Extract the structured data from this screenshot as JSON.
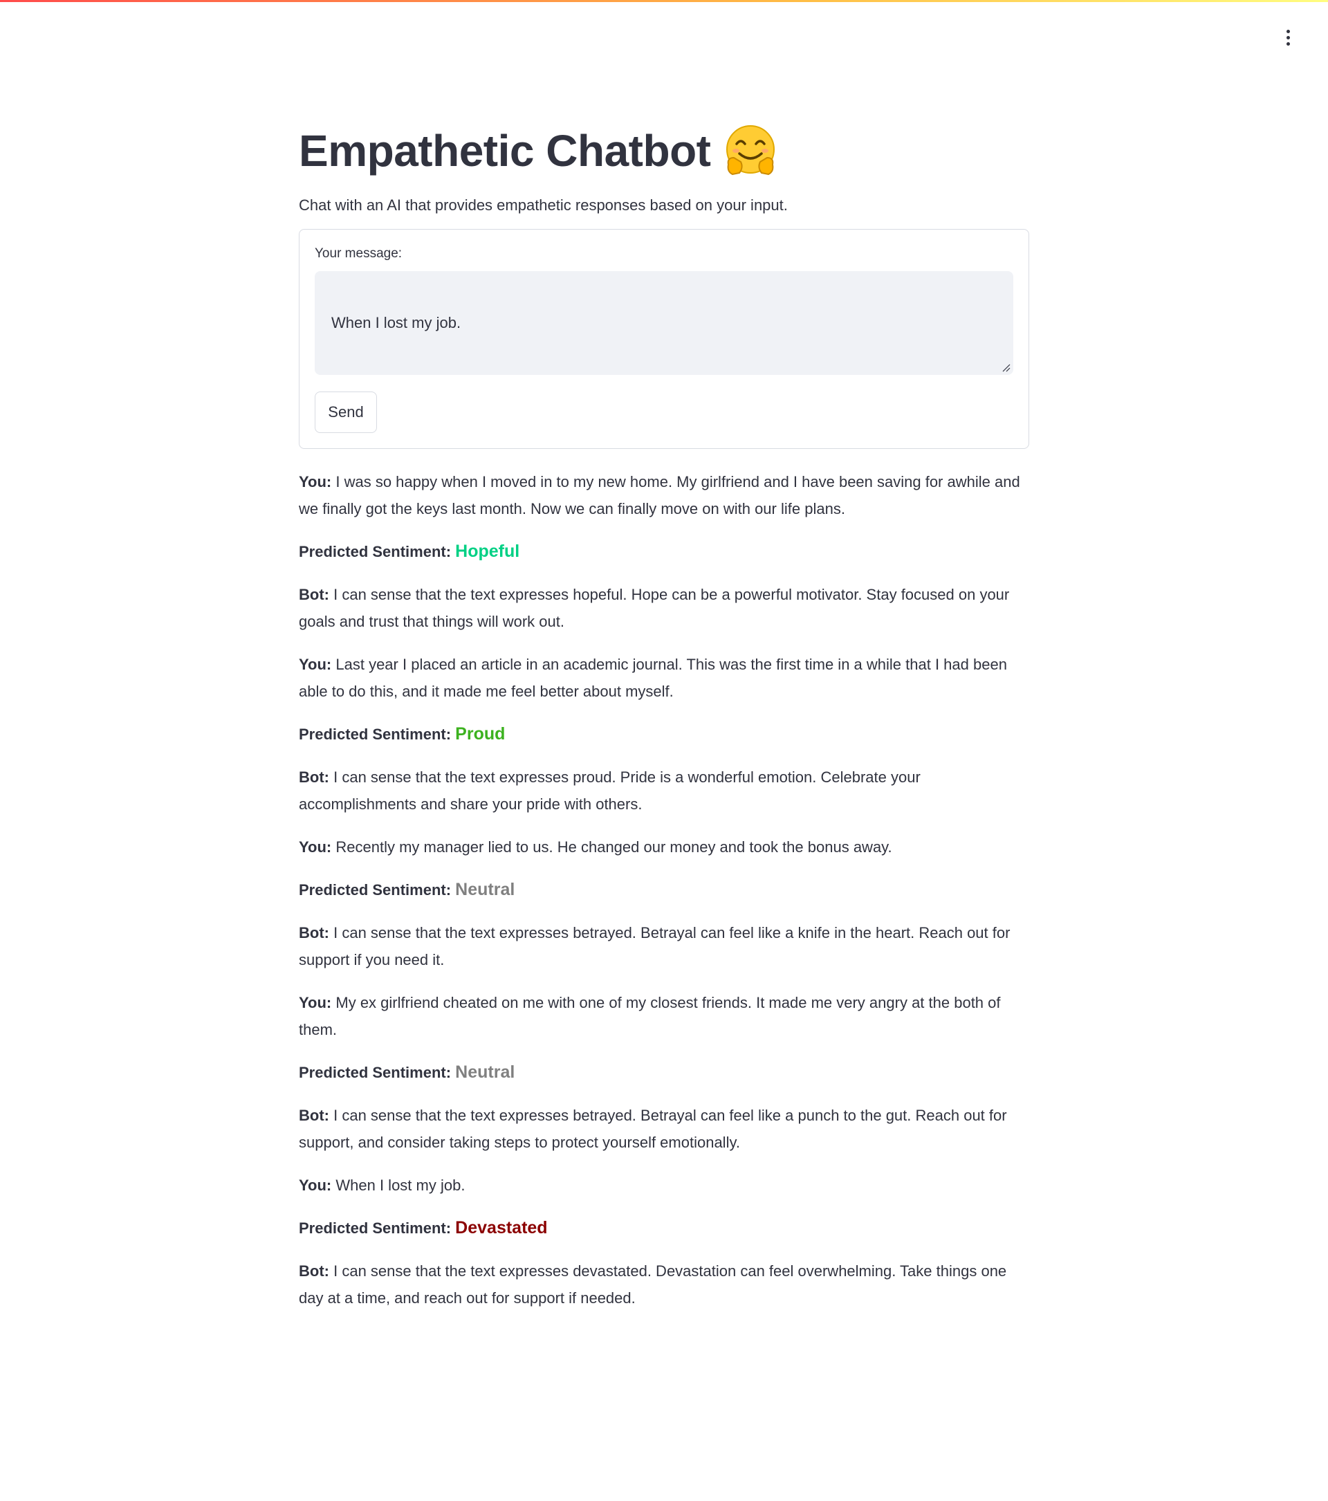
{
  "app": {
    "title": "Empathetic Chatbot",
    "title_emoji": "hugging-face-icon",
    "subtitle": "Chat with an AI that provides empathetic responses based on your input."
  },
  "form": {
    "label": "Your message:",
    "input_value": "When I lost my job.",
    "send_label": "Send"
  },
  "labels": {
    "you": "You:",
    "bot": "Bot:",
    "predicted": "Predicted Sentiment:"
  },
  "colors": {
    "accent_gradient": [
      "#ff4b4b",
      "#ffbd45",
      "#fffd80"
    ],
    "text": "#31333f"
  },
  "conversation": [
    {
      "user": "I was so happy when I moved in to my new home. My girlfriend and I have been saving for awhile and we finally got the keys last month. Now we can finally move on with our life plans.",
      "sentiment": "Hopeful",
      "sentiment_color": "#00d084",
      "bot": "I can sense that the text expresses hopeful. Hope can be a powerful motivator. Stay focused on your goals and trust that things will work out."
    },
    {
      "user": "Last year I placed an article in an academic journal. This was the first time in a while that I had been able to do this, and it made me feel better about myself.",
      "sentiment": "Proud",
      "sentiment_color": "#3cb21f",
      "bot": "I can sense that the text expresses proud. Pride is a wonderful emotion. Celebrate your accomplishments and share your pride with others."
    },
    {
      "user": "Recently my manager lied to us. He changed our money and took the bonus away.",
      "sentiment": "Neutral",
      "sentiment_color": "#808080",
      "bot": "I can sense that the text expresses betrayed. Betrayal can feel like a knife in the heart. Reach out for support if you need it."
    },
    {
      "user": "My ex girlfriend cheated on me with one of my closest friends. It made me very angry at the both of them.",
      "sentiment": "Neutral",
      "sentiment_color": "#808080",
      "bot": "I can sense that the text expresses betrayed. Betrayal can feel like a punch to the gut. Reach out for support, and consider taking steps to protect yourself emotionally."
    },
    {
      "user": "When I lost my job.",
      "sentiment": "Devastated",
      "sentiment_color": "#8b0000",
      "bot": "I can sense that the text expresses devastated. Devastation can feel overwhelming. Take things one day at a time, and reach out for support if needed."
    }
  ]
}
